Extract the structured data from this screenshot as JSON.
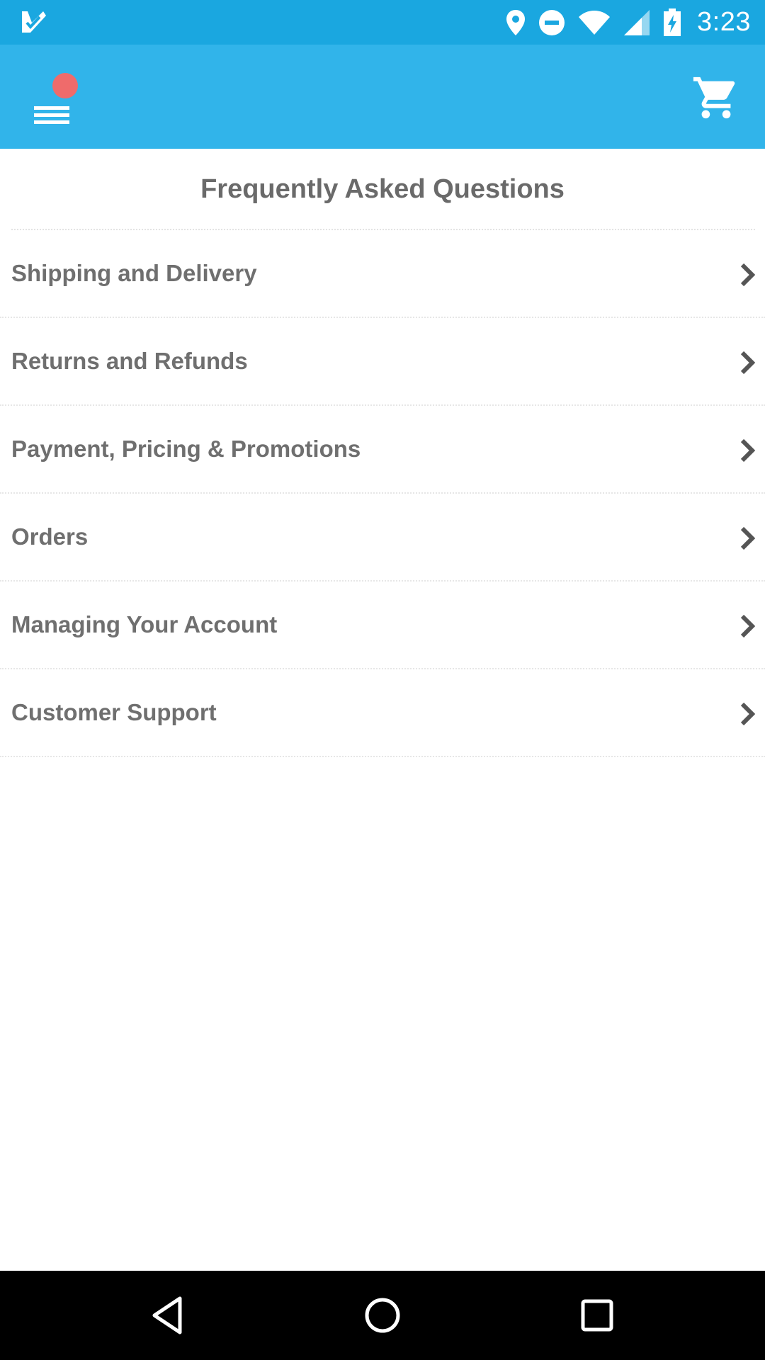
{
  "status_bar": {
    "time": "3:23",
    "left_icon": "checkmark-notification-icon",
    "icons": [
      "location-icon",
      "do-not-disturb-icon",
      "wifi-icon",
      "cell-signal-icon",
      "battery-charging-icon"
    ],
    "background_color": "#1aa7e0"
  },
  "app_bar": {
    "background_color": "#31b4ea",
    "menu_icon": "hamburger-menu-icon",
    "notification_dot_color": "#ef6b6b",
    "cart_icon": "shopping-cart-icon"
  },
  "faq": {
    "title": "Frequently Asked Questions",
    "items": [
      {
        "label": "Shipping and Delivery"
      },
      {
        "label": "Returns and Refunds"
      },
      {
        "label": "Payment, Pricing & Promotions"
      },
      {
        "label": "Orders"
      },
      {
        "label": "Managing Your Account"
      },
      {
        "label": "Customer Support"
      }
    ],
    "item_icon": "chevron-right-icon"
  },
  "nav_bar": {
    "buttons": [
      "back-icon",
      "home-icon",
      "recents-icon"
    ]
  }
}
